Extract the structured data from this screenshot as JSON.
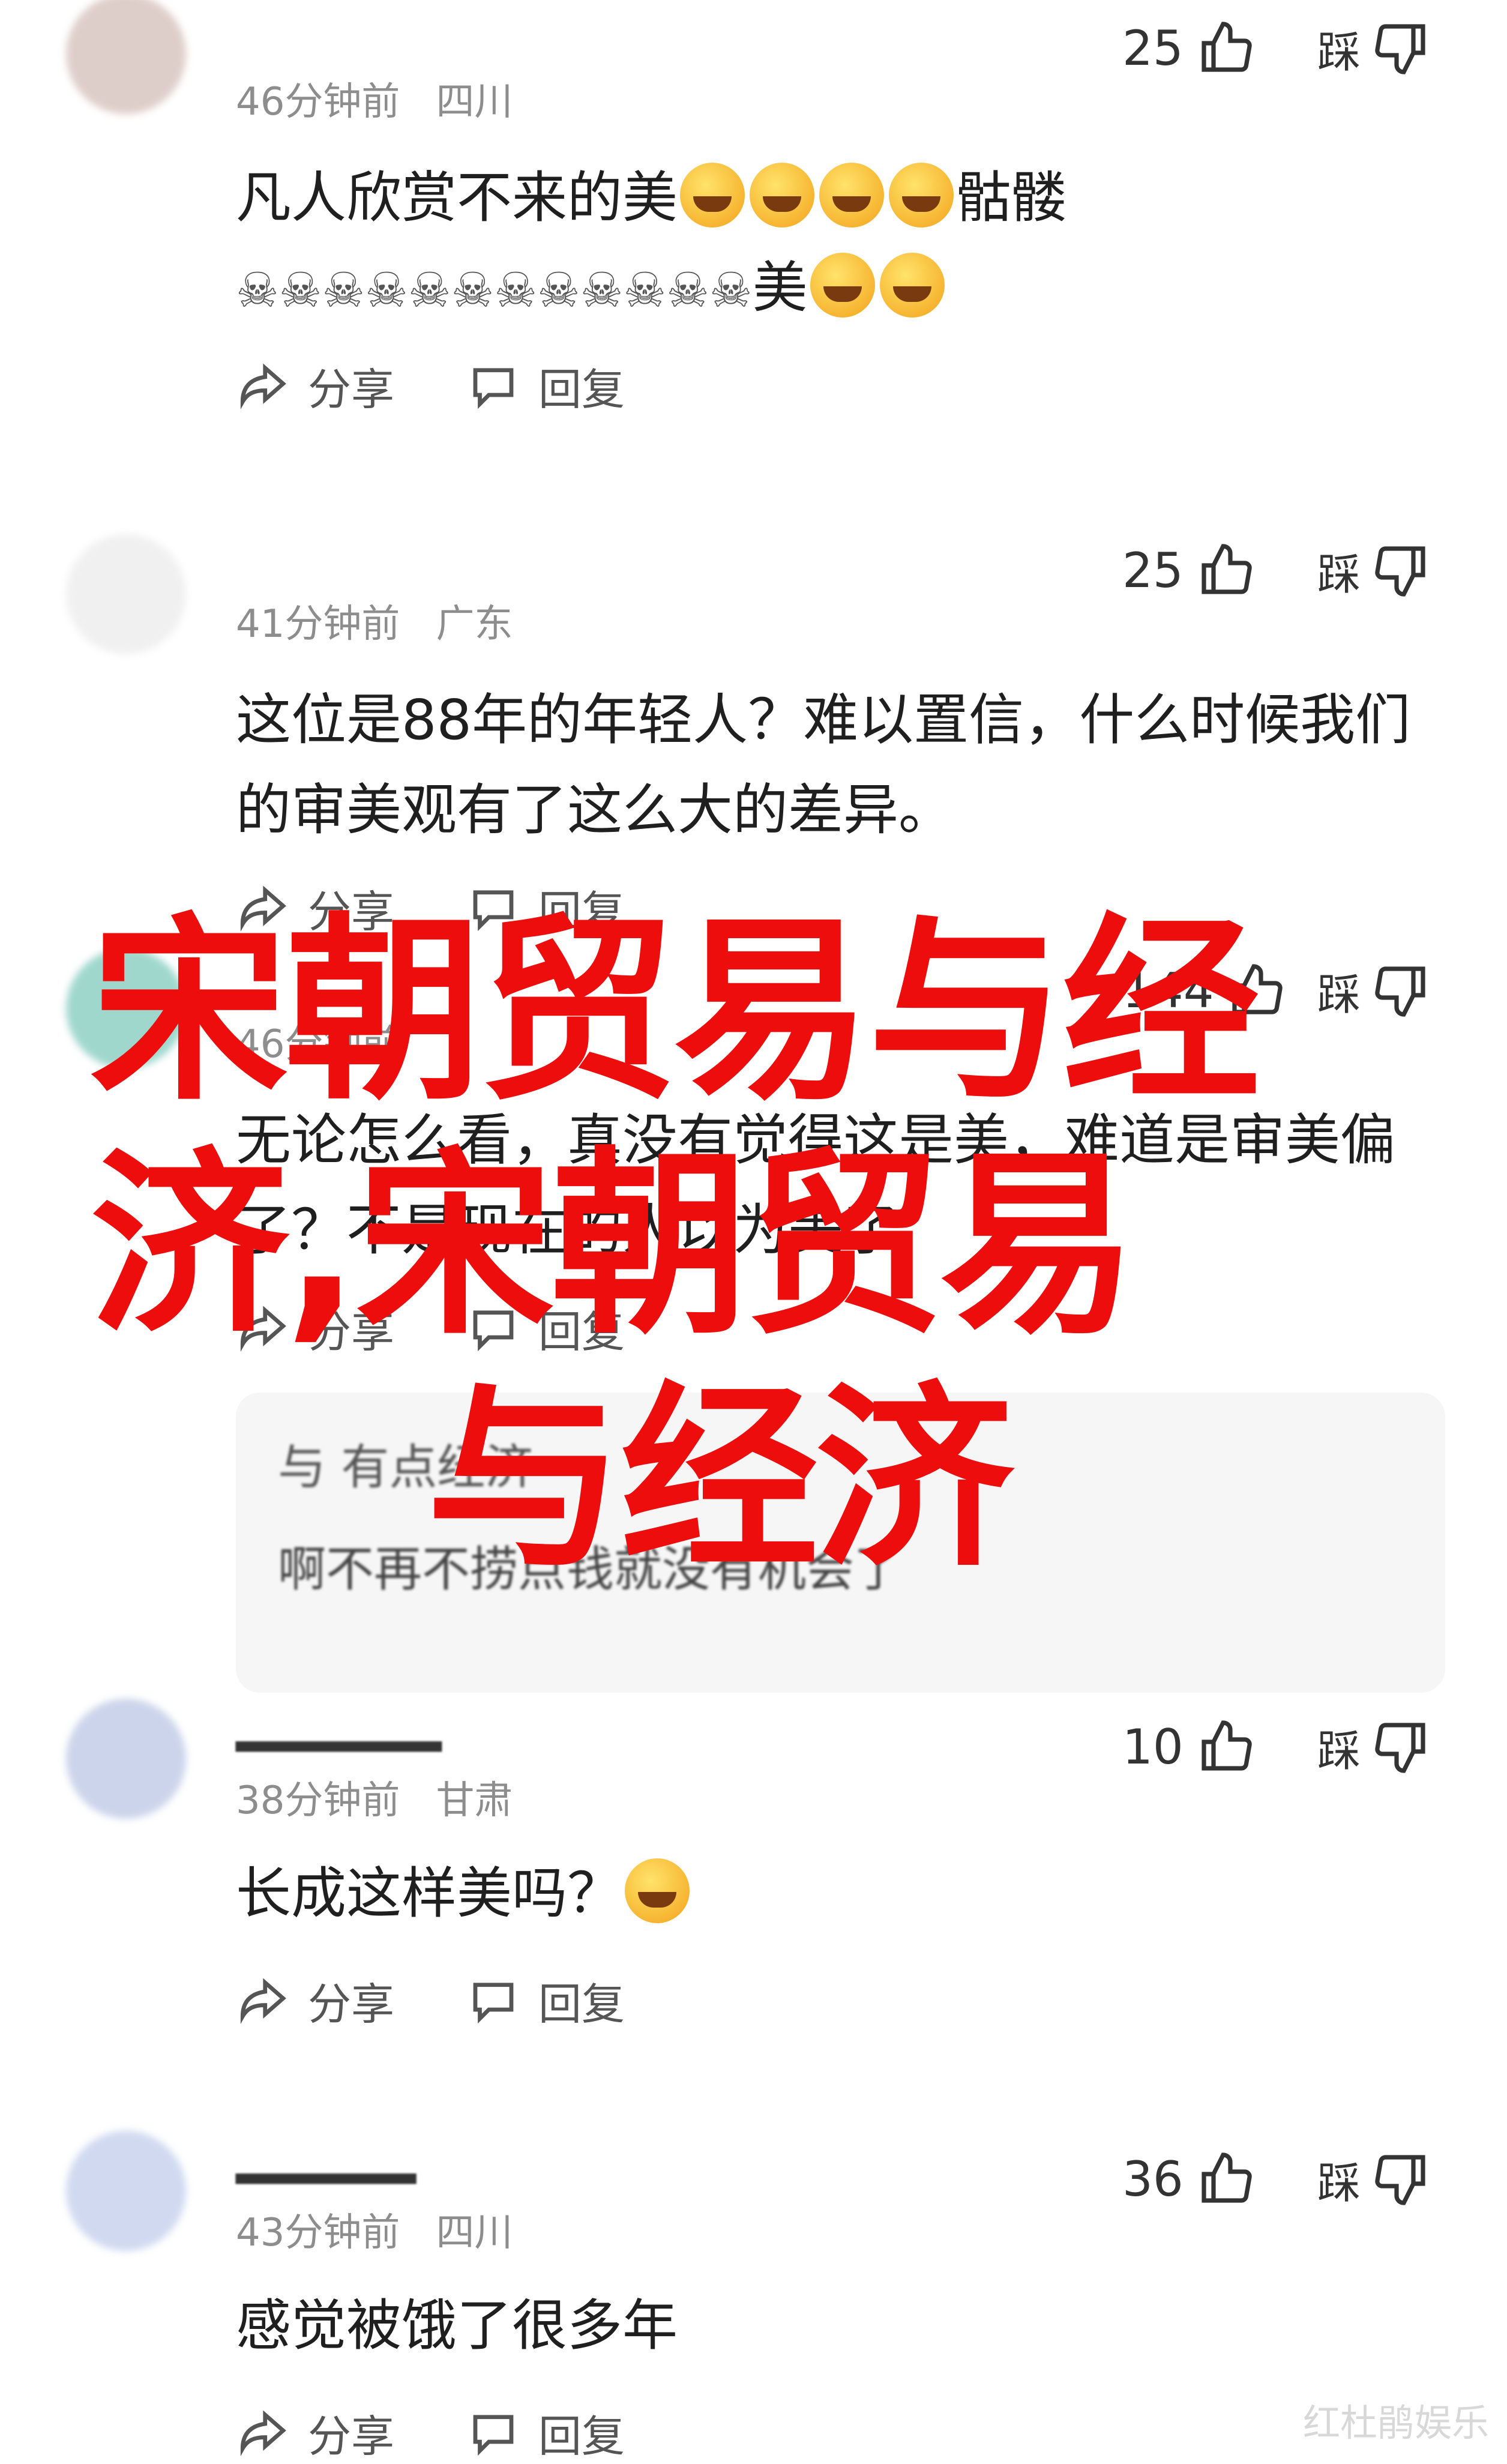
{
  "comments": [
    {
      "user": "",
      "time": "46分钟前",
      "location": "四川",
      "likes": "25",
      "dislike_label": "踩",
      "text_line1": "凡人欣赏不来的美",
      "text_line1_tail": "骷髅",
      "text_line2_tail": "美",
      "share": "分享",
      "reply": "回复",
      "avatar_color": "#d9c6c0"
    },
    {
      "user": "",
      "time": "41分钟前",
      "location": "广东",
      "likes": "25",
      "dislike_label": "踩",
      "text": "这位是88年的年轻人？难以置信，什么时候我们的审美观有了这么大的差异。",
      "share": "分享",
      "reply": "回复",
      "avatar_color": "#eeeeee"
    },
    {
      "user": "",
      "time": "46分钟前",
      "location": "",
      "likes": "144",
      "dislike_label": "踩",
      "text": "无论怎么看，真没有觉得这是美，难道是审美偏了？不是现在的人以为美了",
      "share": "分享",
      "reply": "回复",
      "avatar_color": "#8fd1c4"
    },
    {
      "user": "",
      "time": "38分钟前",
      "location": "甘肃",
      "likes": "10",
      "dislike_label": "踩",
      "text": "长成这样美吗？",
      "share": "分享",
      "reply": "回复",
      "avatar_color": "#c3cde8"
    },
    {
      "user": "",
      "time": "43分钟前",
      "location": "四川",
      "likes": "36",
      "dislike_label": "踩",
      "text": "感觉被饿了很多年",
      "share": "分享",
      "reply": "回复",
      "avatar_color": "#c8d3ee"
    }
  ],
  "reply_box": {
    "line1": "与 有点经济",
    "line2": "啊不再不捞点钱就没有机会了"
  },
  "overlay": {
    "line1": "宋朝贸易与经",
    "line2": "济,宋朝贸易",
    "line3": "与经济",
    "color": "#ee0d0d"
  },
  "watermark": "红杜鹃娱乐"
}
